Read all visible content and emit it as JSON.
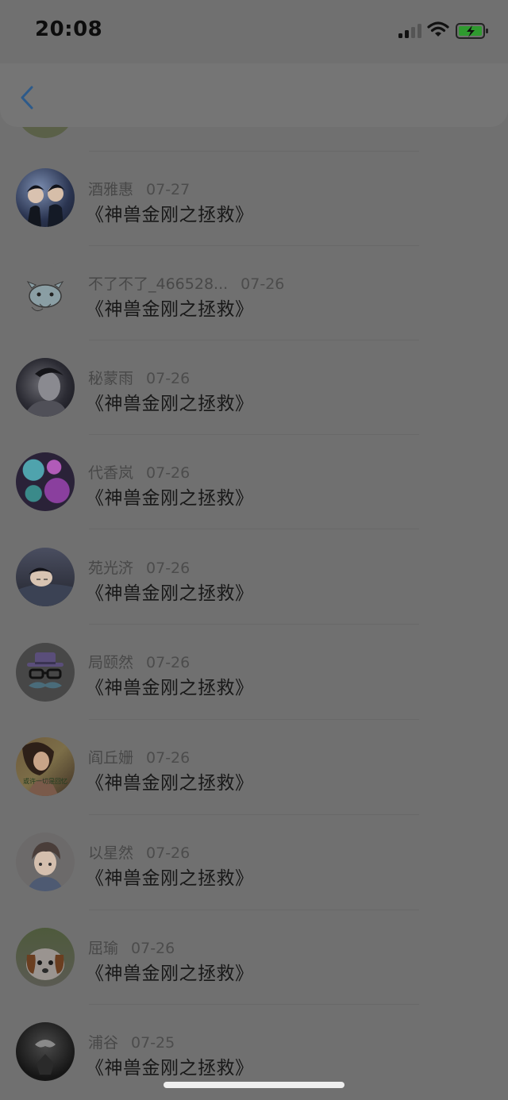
{
  "status": {
    "time": "20:08"
  },
  "items": [
    {
      "name": "酒雅惠",
      "date": "07-27",
      "title": "《神兽金刚之拯救》",
      "avatar_colors": [
        "#4a5a7a",
        "#1f2838"
      ]
    },
    {
      "name": "不了不了_466528...",
      "date": "07-26",
      "title": "《神兽金刚之拯救》",
      "avatar_colors": [
        "#7a7a7a",
        "#6a6a6a"
      ]
    },
    {
      "name": "秘蒙雨",
      "date": "07-26",
      "title": "《神兽金刚之拯救》",
      "avatar_colors": [
        "#3a3a42",
        "#181820"
      ]
    },
    {
      "name": "代香岚",
      "date": "07-26",
      "title": "《神兽金刚之拯救》",
      "avatar_colors": [
        "#3d6f7a",
        "#5e2e6e"
      ]
    },
    {
      "name": "苑光济",
      "date": "07-26",
      "title": "《神兽金刚之拯救》",
      "avatar_colors": [
        "#3a3e4e",
        "#1c1e28"
      ]
    },
    {
      "name": "局颐然",
      "date": "07-26",
      "title": "《神兽金刚之拯救》",
      "avatar_colors": [
        "#4a4a4a",
        "#3a3a3a"
      ]
    },
    {
      "name": "阎丘姗",
      "date": "07-26",
      "title": "《神兽金刚之拯救》",
      "avatar_colors": [
        "#7a6a42",
        "#4a3422"
      ],
      "avatar_caption": "或许一切是回忆"
    },
    {
      "name": "以星然",
      "date": "07-26",
      "title": "《神兽金刚之拯救》",
      "avatar_colors": [
        "#6e6a68",
        "#4e4a4c"
      ]
    },
    {
      "name": "屈瑜",
      "date": "07-26",
      "title": "《神兽金刚之拯救》",
      "avatar_colors": [
        "#6a4428",
        "#5a5a5a"
      ]
    },
    {
      "name": "浦谷",
      "date": "07-25",
      "title": "《神兽金刚之拯救》",
      "avatar_colors": [
        "#2e2e2e",
        "#141414"
      ]
    }
  ]
}
